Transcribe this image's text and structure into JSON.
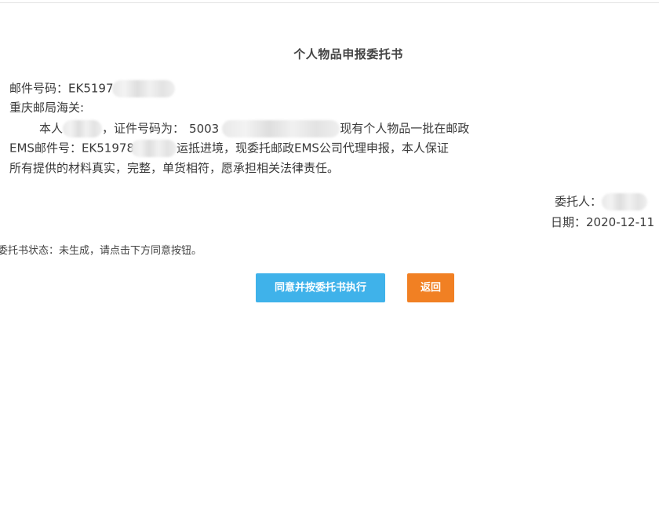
{
  "document": {
    "title": "个人物品申报委托书",
    "mail_number_label": "邮件号码：",
    "mail_number_prefix": "EK5197",
    "addressee": "重庆邮局海关:",
    "body": {
      "line1_start": "本人",
      "line1_id_label": "，证件号码为：",
      "line1_id_prefix": "5003",
      "line1_end": "现有个人物品一批在邮政",
      "line2_label": "EMS邮件号：",
      "line2_number_prefix": "EK51978",
      "line2_end": "运抵进境，现委托邮政EMS公司代理申报，本人保证",
      "line3": "所有提供的材料真实，完整，单货相符，愿承担相关法律责任。"
    },
    "principal_label": "委托人：",
    "date_label": "日期：",
    "date_value": "2020-12-11"
  },
  "status": {
    "text": "委托书状态：未生成，请点击下方同意按钮。"
  },
  "actions": {
    "agree_label": "同意并按委托书执行",
    "back_label": "返回",
    "agree_color": "#3fb2ea",
    "back_color": "#f18023"
  }
}
